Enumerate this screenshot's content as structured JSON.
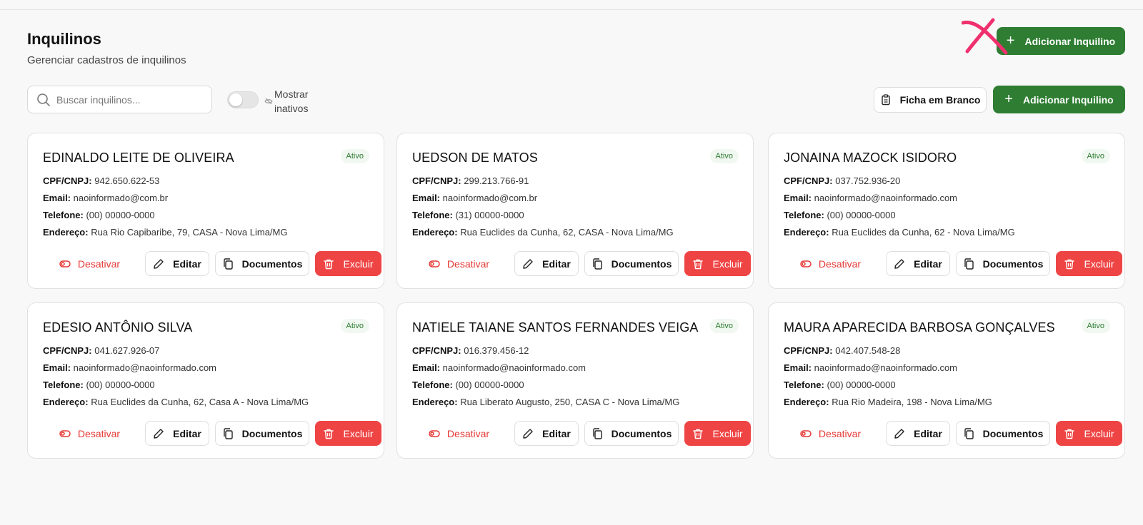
{
  "header": {
    "title": "Inquilinos",
    "subtitle": "Gerenciar cadastros de inquilinos",
    "add_button_label": "Adicionar Inquilino"
  },
  "toolbar": {
    "search_placeholder": "Buscar inquilinos...",
    "search_value": "",
    "toggle_label": "Mostrar inativos",
    "toggle_on": false,
    "blank_form_label": "Ficha em Branco",
    "add_button_label": "Adicionar Inquilino"
  },
  "labels": {
    "cpf": "CPF/CNPJ:",
    "email": "Email:",
    "phone": "Telefone:",
    "address": "Endereço:",
    "deactivate": "Desativar",
    "edit": "Editar",
    "documents": "Documentos",
    "delete": "Excluir"
  },
  "colors": {
    "primary_green": "#2e7d32",
    "danger_red": "#ef4444",
    "annotation_pink": "#f0306e"
  },
  "tenants": [
    {
      "name": "EDINALDO LEITE DE OLIVEIRA",
      "status": "Ativo",
      "cpf": "942.650.622-53",
      "email": "naoinformado@com.br",
      "phone": "(00) 00000-0000",
      "address": "Rua Rio Capibaribe, 79, CASA - Nova Lima/MG"
    },
    {
      "name": "UEDSON DE MATOS",
      "status": "Ativo",
      "cpf": "299.213.766-91",
      "email": "naoinformado@com.br",
      "phone": "(31) 00000-0000",
      "address": "Rua Euclides da Cunha, 62, CASA - Nova Lima/MG"
    },
    {
      "name": "JONAINA MAZOCK ISIDORO",
      "status": "Ativo",
      "cpf": "037.752.936-20",
      "email": "naoinformado@naoinformado.com",
      "phone": "(00) 00000-0000",
      "address": "Rua Euclides da Cunha, 62 - Nova Lima/MG"
    },
    {
      "name": "EDESIO ANTÔNIO SILVA",
      "status": "Ativo",
      "cpf": "041.627.926-07",
      "email": "naoinformado@naoinformado.com",
      "phone": "(00) 00000-0000",
      "address": "Rua Euclides da Cunha, 62, Casa A - Nova Lima/MG"
    },
    {
      "name": "NATIELE TAIANE SANTOS FERNANDES VEIGA",
      "status": "Ativo",
      "cpf": "016.379.456-12",
      "email": "naoinformado@naoinformado.com",
      "phone": "(00) 00000-0000",
      "address": "Rua Liberato Augusto, 250, CASA C - Nova Lima/MG"
    },
    {
      "name": "MAURA APARECIDA BARBOSA GONÇALVES",
      "status": "Ativo",
      "cpf": "042.407.548-28",
      "email": "naoinformado@naoinformado.com",
      "phone": "(00) 00000-0000",
      "address": "Rua Rio Madeira, 198 - Nova Lima/MG"
    }
  ]
}
